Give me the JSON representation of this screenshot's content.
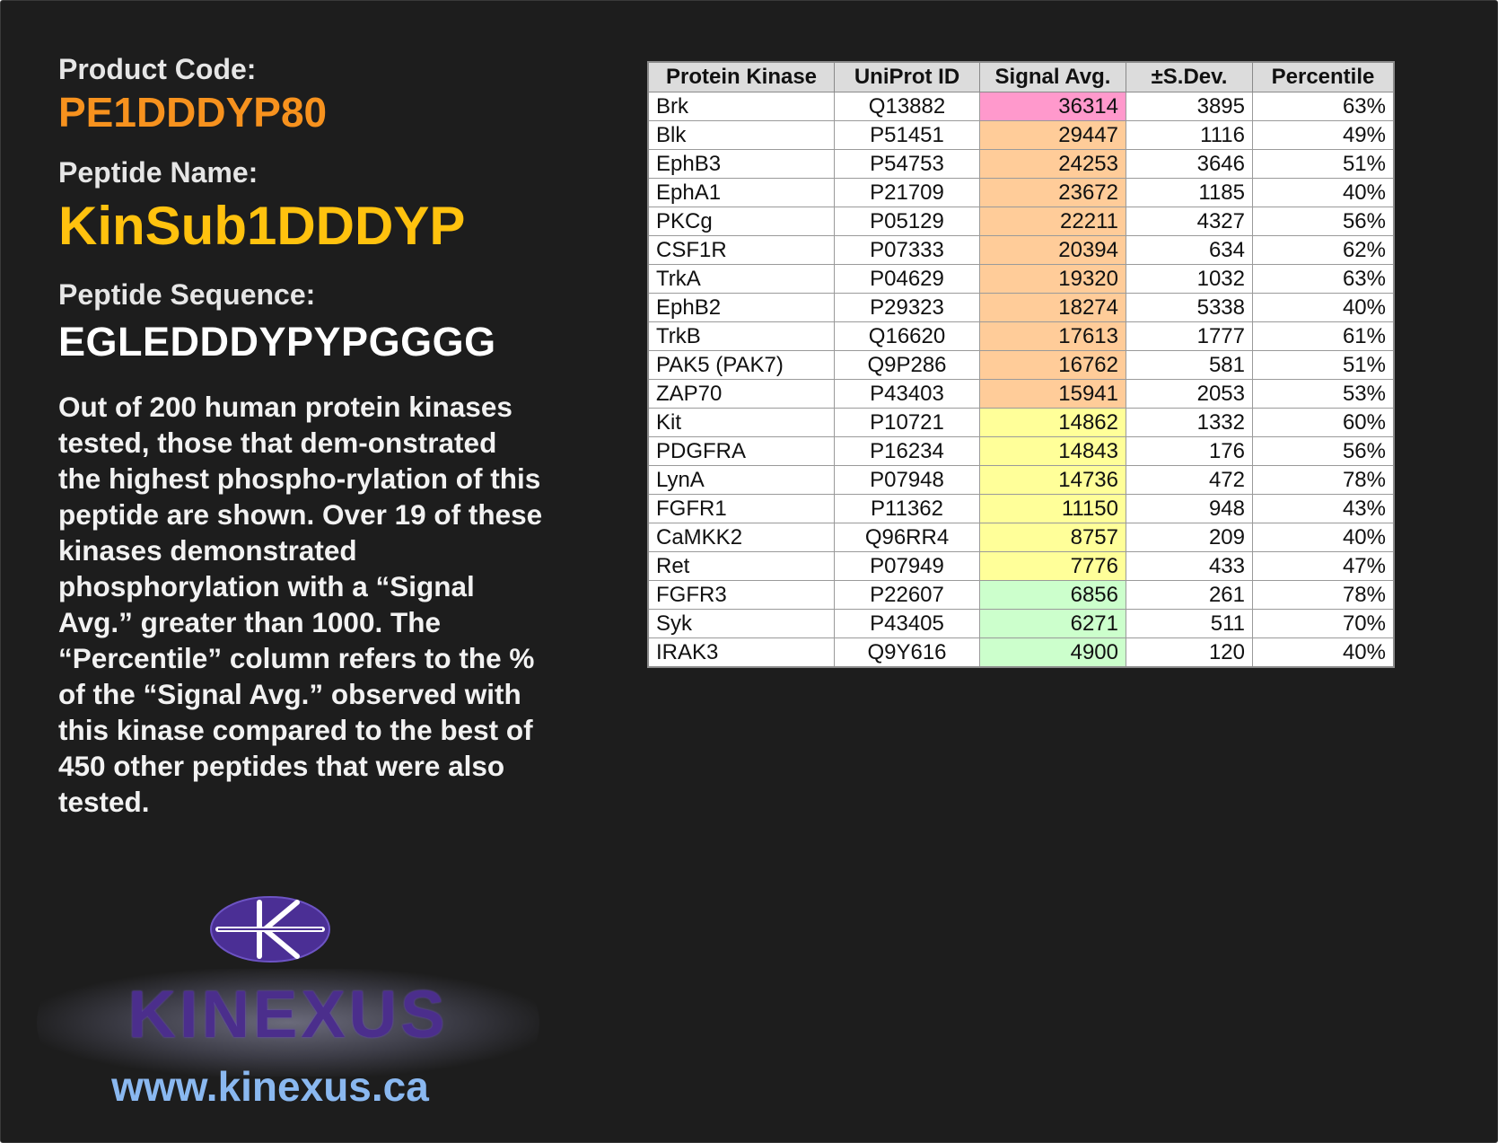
{
  "product": {
    "code_label": "Product Code:",
    "code": "PE1DDDYP80",
    "name_label": "Peptide Name:",
    "name": "KinSub1DDDYP",
    "sequence_label": "Peptide Sequence:",
    "sequence": "EGLEDDDYPYPGGGG"
  },
  "description": "Out of 200 human protein kinases tested, those that dem-onstrated the highest phospho-rylation of this peptide are shown. Over 19 of these kinases demonstrated phosphorylation with a “Signal Avg.” greater than 1000. The “Percentile” column refers to the % of the “Signal Avg.” observed with this kinase compared to the best of 450 other peptides that were also tested.",
  "logo": {
    "wordmark": "KINEXUS",
    "url": "www.kinexus.ca"
  },
  "table": {
    "headers": [
      "Protein Kinase",
      "UniProt ID",
      "Signal Avg.",
      "±S.Dev.",
      "Percentile"
    ],
    "rows": [
      {
        "kinase": "Brk",
        "uniprot": "Q13882",
        "signal": "36314",
        "sd": "3895",
        "pct": "63%",
        "color": "#ff99cc"
      },
      {
        "kinase": "Blk",
        "uniprot": "P51451",
        "signal": "29447",
        "sd": "1116",
        "pct": "49%",
        "color": "#ffcc99"
      },
      {
        "kinase": "EphB3",
        "uniprot": "P54753",
        "signal": "24253",
        "sd": "3646",
        "pct": "51%",
        "color": "#ffcc99"
      },
      {
        "kinase": "EphA1",
        "uniprot": "P21709",
        "signal": "23672",
        "sd": "1185",
        "pct": "40%",
        "color": "#ffcc99"
      },
      {
        "kinase": "PKCg",
        "uniprot": "P05129",
        "signal": "22211",
        "sd": "4327",
        "pct": "56%",
        "color": "#ffcc99"
      },
      {
        "kinase": "CSF1R",
        "uniprot": "P07333",
        "signal": "20394",
        "sd": "634",
        "pct": "62%",
        "color": "#ffcc99"
      },
      {
        "kinase": "TrkA",
        "uniprot": "P04629",
        "signal": "19320",
        "sd": "1032",
        "pct": "63%",
        "color": "#ffcc99"
      },
      {
        "kinase": "EphB2",
        "uniprot": "P29323",
        "signal": "18274",
        "sd": "5338",
        "pct": "40%",
        "color": "#ffcc99"
      },
      {
        "kinase": "TrkB",
        "uniprot": "Q16620",
        "signal": "17613",
        "sd": "1777",
        "pct": "61%",
        "color": "#ffcc99"
      },
      {
        "kinase": "PAK5 (PAK7)",
        "uniprot": "Q9P286",
        "signal": "16762",
        "sd": "581",
        "pct": "51%",
        "color": "#ffcc99"
      },
      {
        "kinase": "ZAP70",
        "uniprot": "P43403",
        "signal": "15941",
        "sd": "2053",
        "pct": "53%",
        "color": "#ffcc99"
      },
      {
        "kinase": "Kit",
        "uniprot": "P10721",
        "signal": "14862",
        "sd": "1332",
        "pct": "60%",
        "color": "#ffff99"
      },
      {
        "kinase": "PDGFRA",
        "uniprot": "P16234",
        "signal": "14843",
        "sd": "176",
        "pct": "56%",
        "color": "#ffff99"
      },
      {
        "kinase": "LynA",
        "uniprot": "P07948",
        "signal": "14736",
        "sd": "472",
        "pct": "78%",
        "color": "#ffff99"
      },
      {
        "kinase": "FGFR1",
        "uniprot": "P11362",
        "signal": "11150",
        "sd": "948",
        "pct": "43%",
        "color": "#ffff99"
      },
      {
        "kinase": "CaMKK2",
        "uniprot": "Q96RR4",
        "signal": "8757",
        "sd": "209",
        "pct": "40%",
        "color": "#ffff99"
      },
      {
        "kinase": "Ret",
        "uniprot": "P07949",
        "signal": "7776",
        "sd": "433",
        "pct": "47%",
        "color": "#ffff99"
      },
      {
        "kinase": "FGFR3",
        "uniprot": "P22607",
        "signal": "6856",
        "sd": "261",
        "pct": "78%",
        "color": "#ccffcc"
      },
      {
        "kinase": "Syk",
        "uniprot": "P43405",
        "signal": "6271",
        "sd": "511",
        "pct": "70%",
        "color": "#ccffcc"
      },
      {
        "kinase": "IRAK3",
        "uniprot": "Q9Y616",
        "signal": "4900",
        "sd": "120",
        "pct": "40%",
        "color": "#ccffcc"
      }
    ]
  }
}
